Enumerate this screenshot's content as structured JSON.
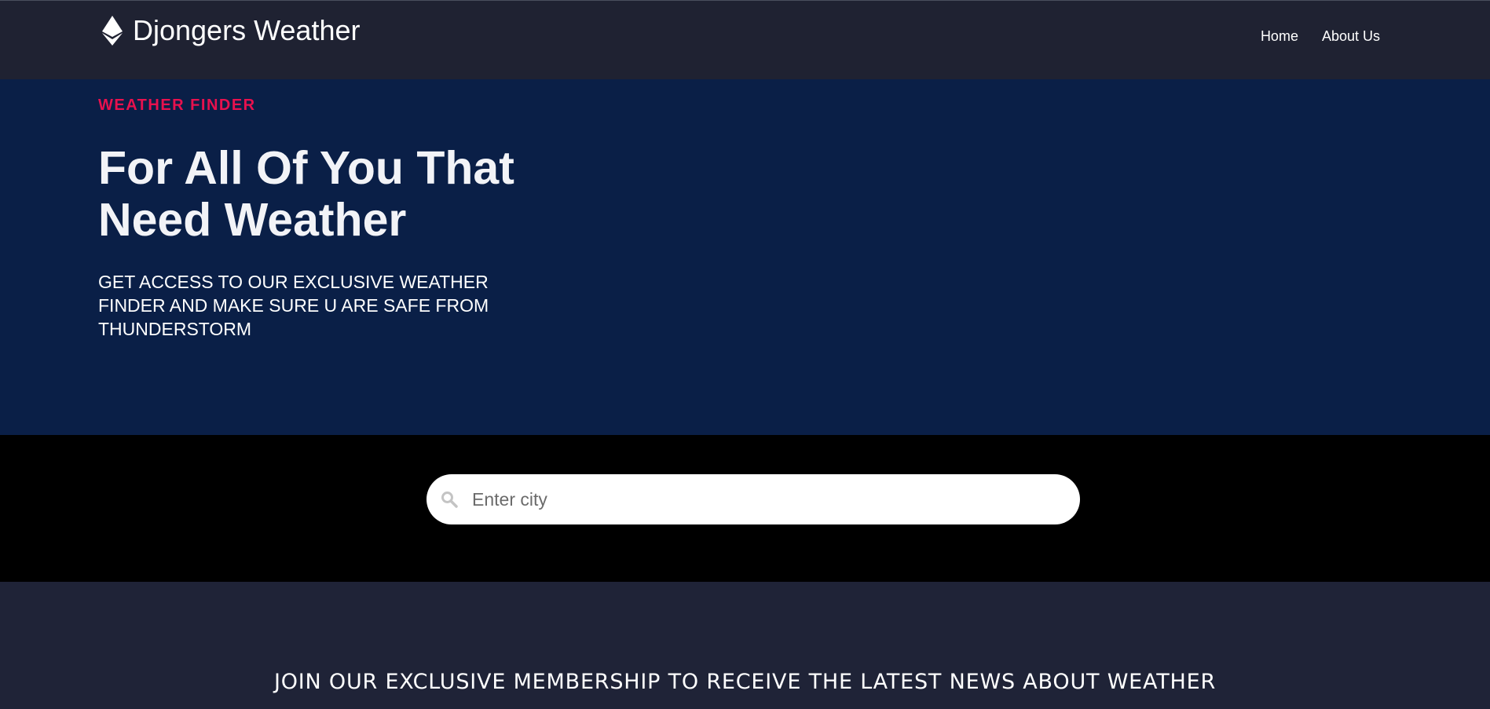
{
  "navbar": {
    "brand": "Djongers Weather",
    "brand_icon": "ethereum-icon",
    "links": [
      "Home",
      "About Us"
    ]
  },
  "hero": {
    "eyebrow": "WEATHER FINDER",
    "title": "For All Of You That Need Weather",
    "subtitle": "GET ACCESS TO OUR EXCLUSIVE WEATHER FINDER AND MAKE SURE U ARE SAFE FROM THUNDERSTORM"
  },
  "search": {
    "icon": "search-icon",
    "placeholder": "Enter city",
    "value": ""
  },
  "membership": {
    "title": "JOIN OUR EXCLUSIVE MEMBERSHIP TO RECEIVE THE LATEST NEWS ABOUT WEATHER"
  },
  "colors": {
    "navbar_bg": "#1f2232",
    "hero_bg": "#0a1f47",
    "accent": "#e8114e",
    "search_band_bg": "#000000",
    "membership_bg": "#1f2337"
  }
}
